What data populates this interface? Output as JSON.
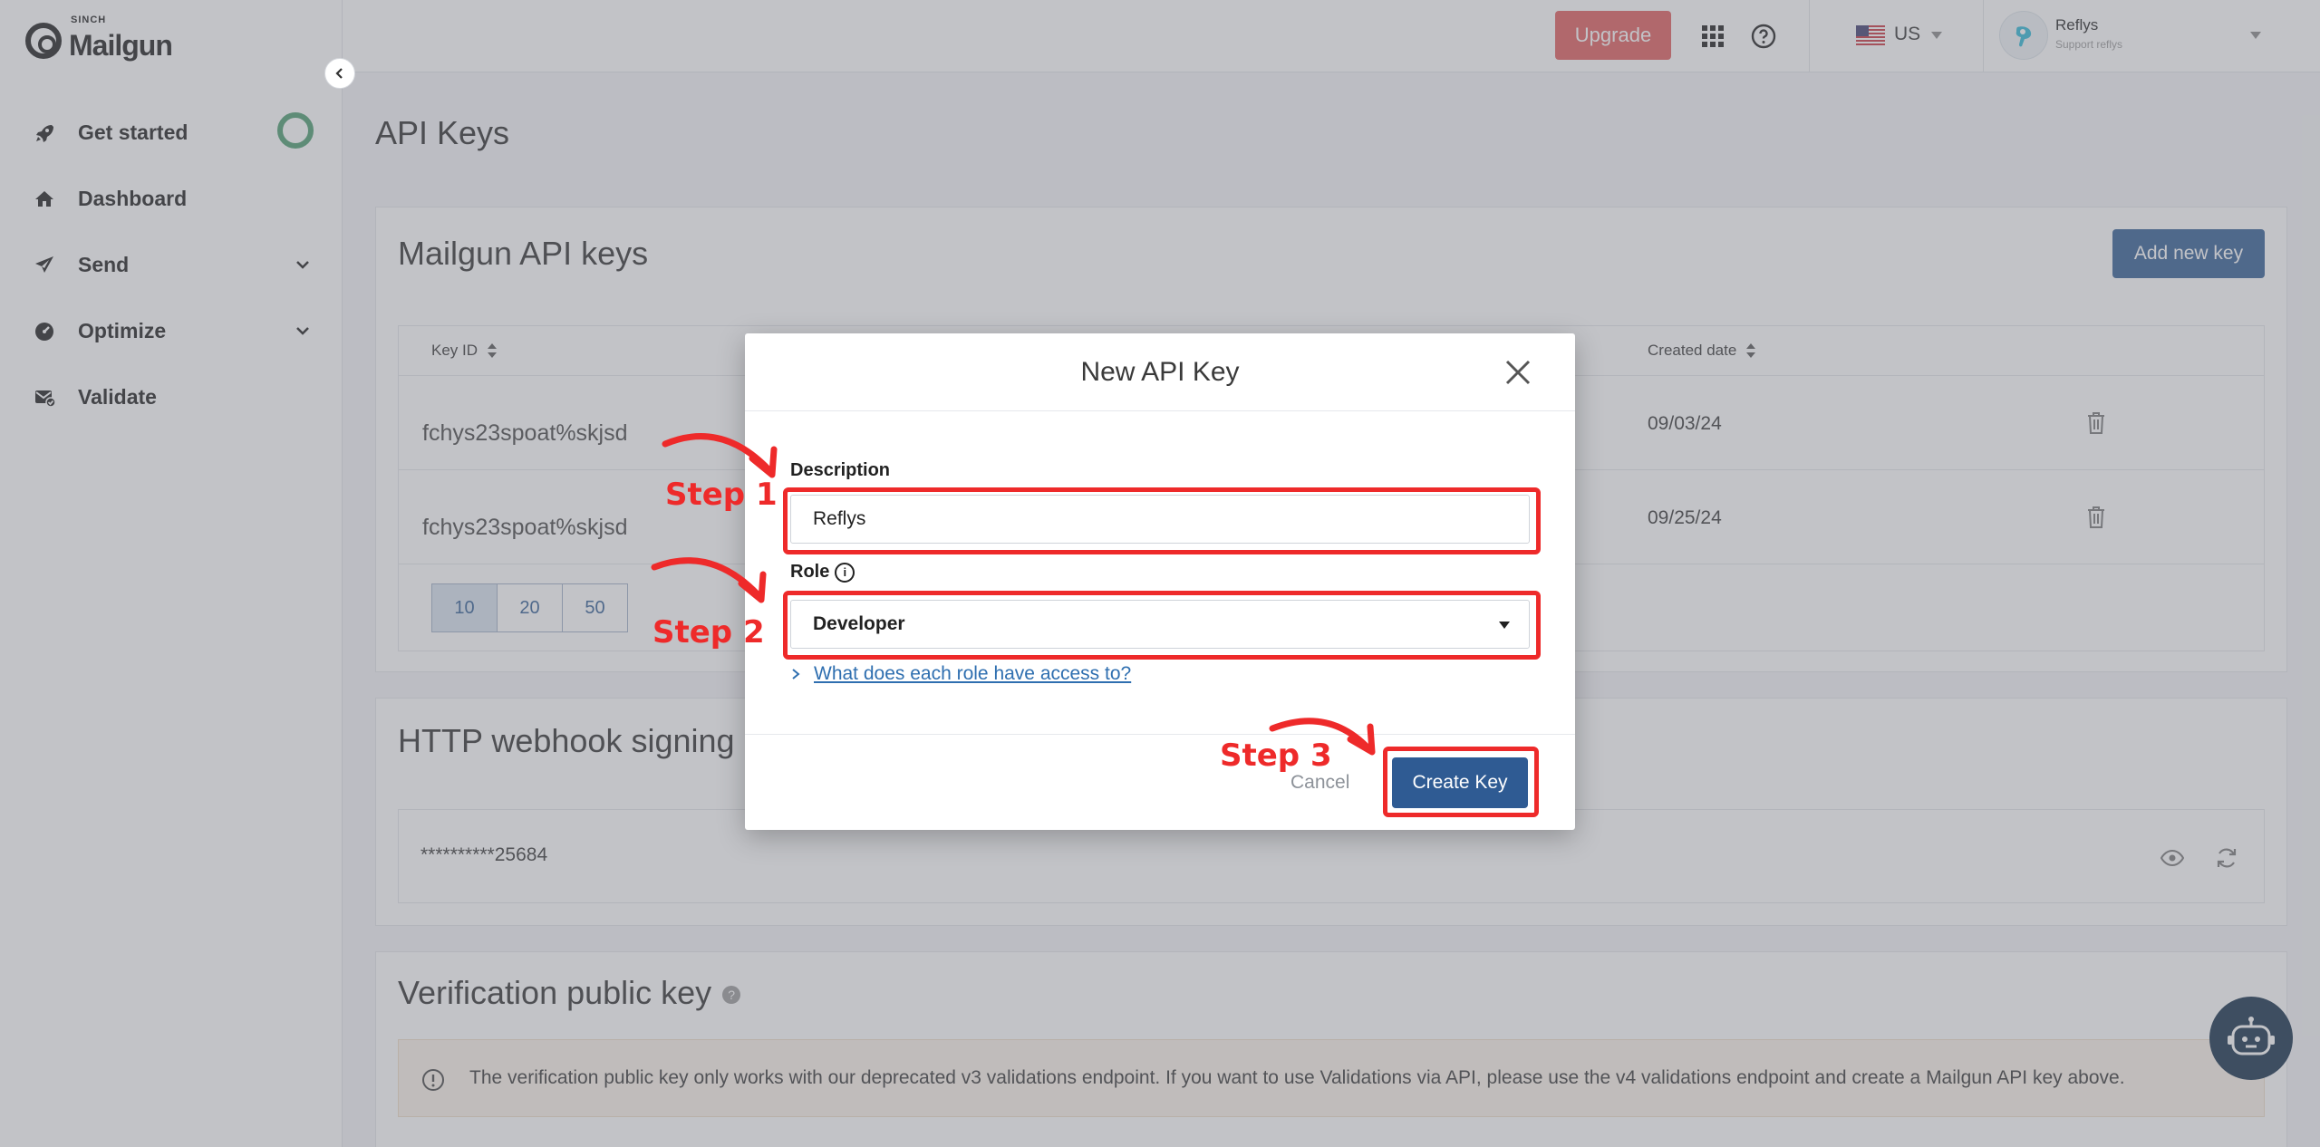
{
  "brand": {
    "small": "SINCH",
    "name": "Mailgun"
  },
  "sidebar": {
    "items": [
      {
        "label": "Get started"
      },
      {
        "label": "Dashboard"
      },
      {
        "label": "Send"
      },
      {
        "label": "Optimize"
      },
      {
        "label": "Validate"
      }
    ]
  },
  "topbar": {
    "upgrade_label": "Upgrade",
    "region": "US",
    "user_name": "Reflys",
    "user_sub": "Support reflys"
  },
  "page": {
    "title": "API Keys"
  },
  "api_keys_card": {
    "title": "Mailgun API keys",
    "add_button": "Add new key",
    "columns": [
      "Key ID",
      "Created date"
    ],
    "rows": [
      {
        "key_id": "fchys23spoat%skjsd",
        "created": "09/03/24"
      },
      {
        "key_id": "fchys23spoat%skjsd",
        "created": "09/25/24"
      }
    ],
    "page_sizes": [
      "10",
      "20",
      "50"
    ]
  },
  "webhook_card": {
    "title": "HTTP webhook signing",
    "masked_key": "**********25684"
  },
  "verification_card": {
    "title": "Verification public key",
    "notice": "The verification public key only works with our deprecated v3 validations endpoint. If you want to use Validations via API, please use the v4 validations endpoint and create a Mailgun API key above."
  },
  "modal": {
    "title": "New API Key",
    "description_label": "Description",
    "description_value": "Reflys",
    "role_label": "Role",
    "role_value": "Developer",
    "role_link": "What does each role have access to?",
    "cancel_label": "Cancel",
    "create_label": "Create Key"
  },
  "annotations": {
    "step1": "Step 1",
    "step2": "Step 2",
    "step3": "Step 3",
    "color": "#ee2a2a"
  },
  "colors": {
    "primary": "#2f5b93",
    "upgrade": "#e05a5a",
    "progress": "#4a9b6e",
    "bot": "#0f2a45"
  }
}
